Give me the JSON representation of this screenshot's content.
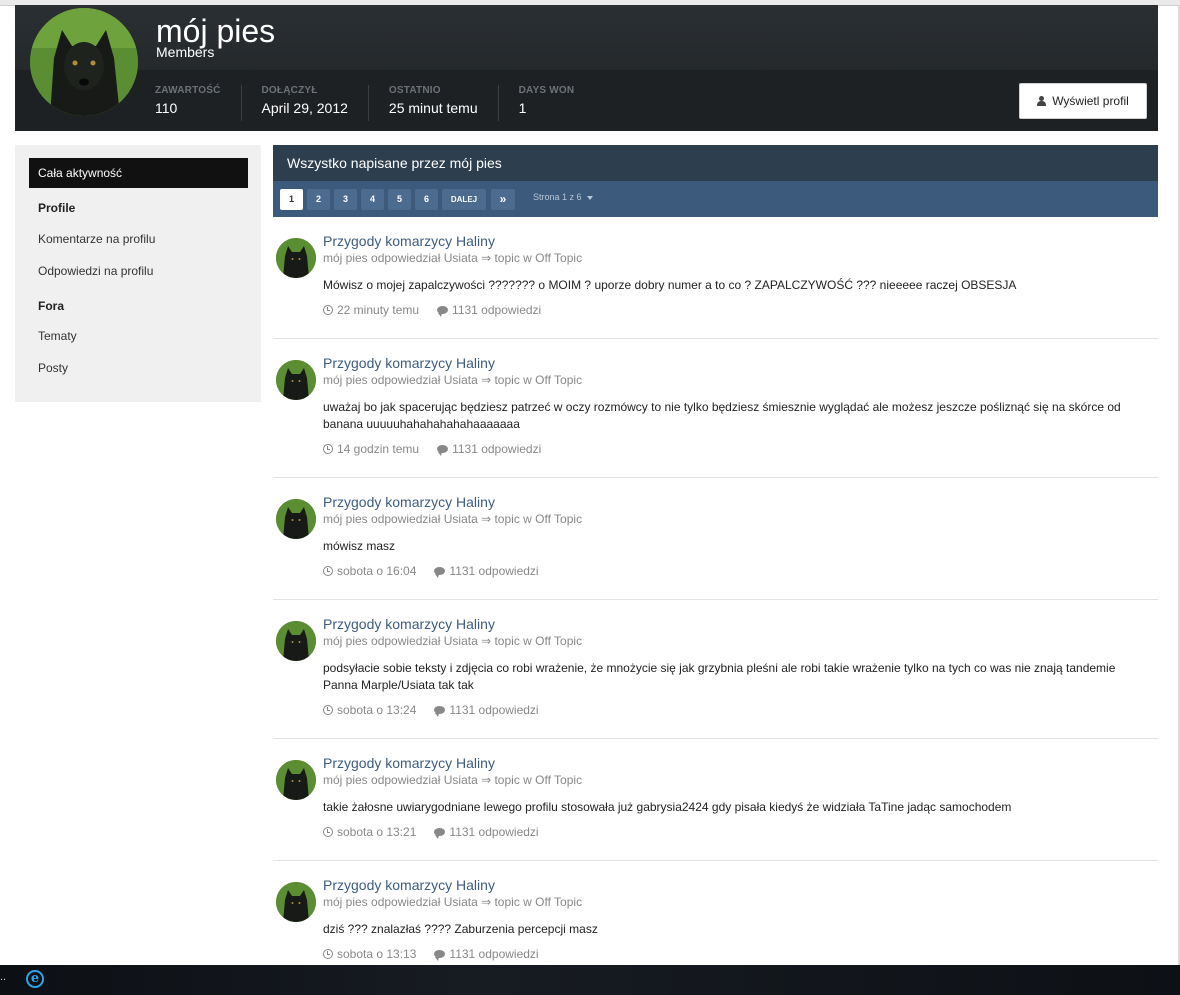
{
  "profile": {
    "name": "mój pies",
    "group": "Members",
    "stats": [
      {
        "label": "Zawartość",
        "value": "110"
      },
      {
        "label": "Dołączył",
        "value": "April 29, 2012"
      },
      {
        "label": "Ostatnio",
        "value": "25 minut temu"
      },
      {
        "label": "Days Won",
        "value": "1"
      }
    ],
    "view_profile_label": "Wyświetl profil"
  },
  "sidebar": {
    "active_label": "Cała aktywność",
    "section_profile": "Profile",
    "profile_items": [
      "Komentarze na profilu",
      "Odpowiedzi na profilu"
    ],
    "section_fora": "Fora",
    "fora_items": [
      "Tematy",
      "Posty"
    ]
  },
  "content": {
    "title": "Wszystko napisane przez mój pies",
    "pagination": {
      "pages": [
        "1",
        "2",
        "3",
        "4",
        "5",
        "6"
      ],
      "current": "1",
      "next_label": "DALEJ",
      "last_label": "»",
      "page_label": "Strona 1 z 6"
    },
    "posts": [
      {
        "title": "Przygody komarzycy Haliny",
        "meta": "mój pies odpowiedział Usiata ⇒ topic w Off Topic",
        "body": "Mówisz o mojej zapalczywości ??????? o MOIM ? uporze dobry numer a to co ? ZAPALCZYWOŚĆ ??? nieeeee raczej OBSESJA",
        "time": "22 minuty temu",
        "replies": "1131 odpowiedzi"
      },
      {
        "title": "Przygody komarzycy Haliny",
        "meta": "mój pies odpowiedział Usiata ⇒ topic w Off Topic",
        "body": "uważaj bo jak spacerując będziesz patrzeć w oczy rozmówcy to nie tylko będziesz śmiesznie wyglądać ale możesz jeszcze pośliznąć się na skórce od banana uuuuuhahahahahahaaaaaaa",
        "time": "14 godzin temu",
        "replies": "1131 odpowiedzi"
      },
      {
        "title": "Przygody komarzycy Haliny",
        "meta": "mój pies odpowiedział Usiata ⇒ topic w Off Topic",
        "body": "mówisz masz",
        "time": "sobota o 16:04",
        "replies": "1131 odpowiedzi"
      },
      {
        "title": "Przygody komarzycy Haliny",
        "meta": "mój pies odpowiedział Usiata ⇒ topic w Off Topic",
        "body": "podsyłacie sobie teksty i zdjęcia co robi wrażenie, że mnożycie się jak grzybnia pleśni ale robi takie wrażenie tylko na tych co was nie znają tandemie Panna Marple/Usiata tak tak",
        "time": "sobota o 13:24",
        "replies": "1131 odpowiedzi"
      },
      {
        "title": "Przygody komarzycy Haliny",
        "meta": "mój pies odpowiedział Usiata ⇒ topic w Off Topic",
        "body": "takie żałosne uwiarygodniane lewego profilu stosowała już gabrysia2424 gdy pisała kiedyś że widziała TaTine jadąc samochodem",
        "time": "sobota o 13:21",
        "replies": "1131 odpowiedzi"
      },
      {
        "title": "Przygody komarzycy Haliny",
        "meta": "mój pies odpowiedział Usiata ⇒ topic w Off Topic",
        "body": "dziś ??? znalazłaś ???? Zaburzenia percepcji masz",
        "time": "sobota o 13:13",
        "replies": "1131 odpowiedzi"
      }
    ]
  },
  "taskbar": {
    "dots": "..",
    "browser_icon": "ie-icon"
  },
  "colors": {
    "header_bg": "#202427",
    "content_title_bg": "#2d3f4f",
    "pagination_bg": "#3c5a7c",
    "link": "#3d5d80",
    "sidebar_bg": "#f0f0f0"
  }
}
